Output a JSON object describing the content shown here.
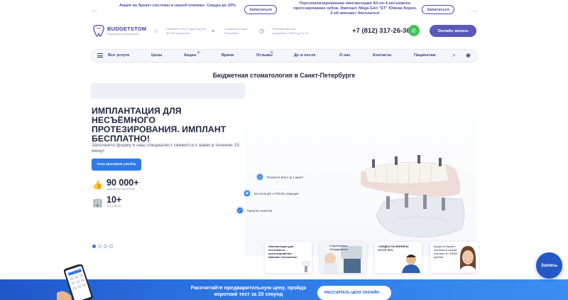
{
  "promo_bar": {
    "text_1": "Акция на брекет-системы в нашей клинике: Скидка до 20%",
    "button_1": "Записаться",
    "text_2": "Персонализированная имплантация All-on-4 несъёмное протезирование зубов. Имплант Mega Gen \"ST\" Южная Корея, 2-ой имплант бесплатно!",
    "button_2": "Записаться"
  },
  "header": {
    "logo_title": "BUDGETSTOM",
    "logo_subtitle": "бюджетная стоматология",
    "info_1": "Работаем с 2012 года Помогли 90 000 пациентам",
    "info_2": "3 клиники в Санкт-Петербурге",
    "info_3": "Работаем для вас ежедневно с 09:00 до 21:00",
    "phone": "+7 (812) 317-26-36",
    "online_button": "Онлайн запись"
  },
  "nav": {
    "items": [
      "Все услуги",
      "Цены",
      "Акции",
      "Врачи",
      "Отзывы",
      "До и после",
      "О нас",
      "Контакты",
      "Пациентам"
    ]
  },
  "page_title": "Бюджетная стоматология в Санкт-Петербурге",
  "hero": {
    "title": "ИМПЛАНТАЦИЯ ДЛЯ НЕСЪЁМНОГО ПРОТЕЗИРОВАНИЯ. ИМПЛАНТ БЕСПЛАТНО!",
    "subtitle": "Заполните форму и наш специалист свяжется с вами в течение 15 минут",
    "button": "Хочу красивую улыбку",
    "stat_1_number": "90 000+",
    "stat_1_label": "довольных пациентов",
    "stat_2_number": "10+",
    "stat_2_label": "лет работы",
    "features": [
      "Результат всего за 1 визит!",
      "Без боли ДО и ПОСЛЕ операции",
      "Гарантия качества"
    ],
    "slide_count": 4,
    "active_slide": 1
  },
  "cards": [
    {
      "text": "Имплантация для несъёмного протезирования. Имплант бесплатно!"
    },
    {
      "text": "Современное оборудование"
    },
    {
      "text": "СКИДКА НА ВИНИРЫ ELITE 30%"
    },
    {
      "text": "Акция на брекет-системы в нашей клинике: от 15000 рублей."
    }
  ],
  "record_button": "Запись",
  "banner": {
    "text": "Рассчитайте предварительную цену, пройдя короткий тест за 20 секунд",
    "button": "РАССЧИТАТЬ ЦЕНУ ОНЛАЙН →"
  },
  "colors": {
    "brand": "#3d3f8f",
    "accent": "#2f7ae6",
    "online_button": "#5a58b8",
    "whatsapp": "#45c15a"
  }
}
